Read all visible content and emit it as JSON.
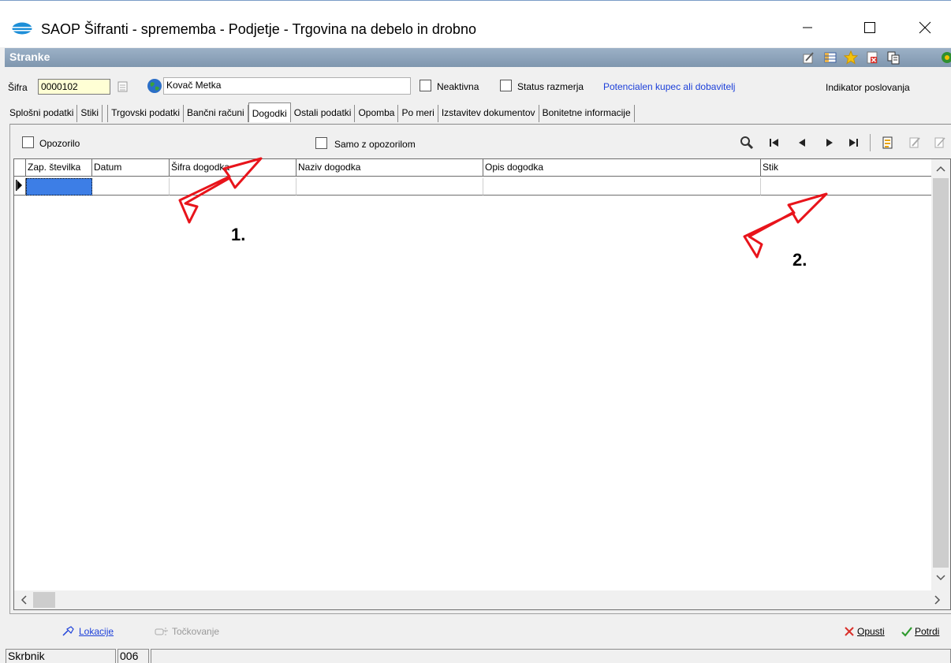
{
  "window": {
    "title": "SAOP Šifranti - sprememba - Podjetje - Trgovina na debelo in drobno"
  },
  "section": {
    "title": "Stranke"
  },
  "form": {
    "sifra_label": "Šifra",
    "sifra_value": "0000102",
    "name_value": "Kovač Metka",
    "neaktivna_label": "Neaktivna",
    "status_label": "Status razmerja",
    "status_value": "Potencialen kupec ali dobavitelj",
    "indikator_label": "Indikator poslovanja"
  },
  "tabs": [
    {
      "label": "Splošni podatki",
      "active": false
    },
    {
      "label": "Stiki",
      "active": false
    },
    {
      "label": "Trgovski podatki",
      "active": false
    },
    {
      "label": "Bančni računi",
      "active": false
    },
    {
      "label": "Dogodki",
      "active": true
    },
    {
      "label": "Ostali podatki",
      "active": false
    },
    {
      "label": "Opomba",
      "active": false
    },
    {
      "label": "Po meri",
      "active": false
    },
    {
      "label": "Izstavitev dokumentov",
      "active": false
    },
    {
      "label": "Bonitetne informacije",
      "active": false
    }
  ],
  "filters": {
    "opozorilo_label": "Opozorilo",
    "samo_label": "Samo z opozorilom"
  },
  "grid": {
    "columns": [
      "Zap. številka",
      "Datum",
      "Šifra dogodka",
      "Naziv dogodka",
      "Opis dogodka",
      "Stik"
    ],
    "rows": [
      [
        "",
        "",
        "",
        "",
        "",
        ""
      ]
    ]
  },
  "annotations": {
    "one": "1.",
    "two": "2.",
    "color": "#e8141b"
  },
  "bottom": {
    "lokacije": "Lokacije",
    "tockovanje": "Točkovanje",
    "opusti": "Opusti",
    "potrdi": "Potrdi"
  },
  "status": {
    "label": "Skrbnik",
    "value": "006"
  }
}
